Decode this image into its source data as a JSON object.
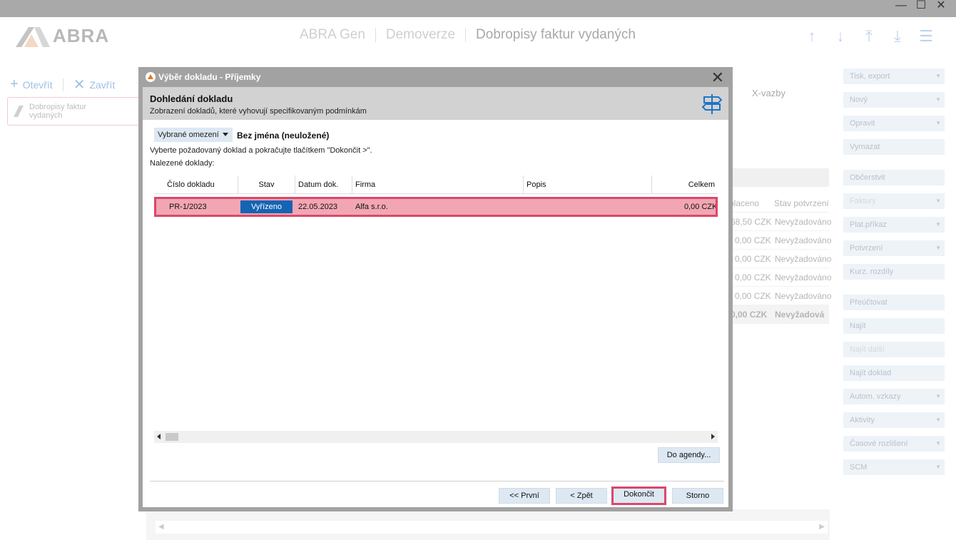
{
  "window": {
    "controls": [
      "—",
      "☐",
      "✕"
    ]
  },
  "app": {
    "logo_text": "ABRA",
    "breadcrumbs": [
      "ABRA Gen",
      "Demoverze",
      "Dobropisy faktur vydaných"
    ],
    "toolbar": {
      "open_label": "Otevřít",
      "close_label": "Zavřít"
    },
    "left_tab_label": "Dobropisy faktur vydaných",
    "bg_tab": "X-vazby",
    "bg_columns": [
      "placeno",
      "Stav potvrzení"
    ],
    "bg_rows": [
      {
        "amount": "68,50 CZK",
        "status": "Nevyžadováno"
      },
      {
        "amount": "0,00 CZK",
        "status": "Nevyžadováno"
      },
      {
        "amount": "0,00 CZK",
        "status": "Nevyžadováno"
      },
      {
        "amount": "0,00 CZK",
        "status": "Nevyžadováno"
      },
      {
        "amount": "0,00 CZK",
        "status": "Nevyžadováno"
      },
      {
        "amount": "0,00 CZK",
        "status": "Nevyžadová"
      }
    ],
    "right_buttons": [
      {
        "label": "Tisk, export",
        "dropdown": true
      },
      {
        "label": "Nový",
        "dropdown": true
      },
      {
        "label": "Opravit",
        "dropdown": true
      },
      {
        "label": "Vymazat",
        "dropdown": false
      },
      {
        "label": "Občerstvit",
        "dropdown": false
      },
      {
        "label": "Faktury",
        "dropdown": true
      },
      {
        "label": "Plat.příkaz",
        "dropdown": true
      },
      {
        "label": "Potvrzení",
        "dropdown": true
      },
      {
        "label": "Kurz. rozdíly",
        "dropdown": false
      },
      {
        "label": "Přeúčtovat",
        "dropdown": false
      },
      {
        "label": "Najít",
        "dropdown": false
      },
      {
        "label": "Najít další",
        "dropdown": false
      },
      {
        "label": "Najít doklad",
        "dropdown": false
      },
      {
        "label": "Autom. vzkazy",
        "dropdown": true
      },
      {
        "label": "Aktivity",
        "dropdown": true
      },
      {
        "label": "Časové rozlišení",
        "dropdown": true
      },
      {
        "label": "SCM",
        "dropdown": true
      }
    ]
  },
  "dialog": {
    "title": "Výběr dokladu - Příjemky",
    "header_title": "Dohledání dokladu",
    "header_subtitle": "Zobrazení dokladů, které vyhovují specifikovaným podmínkám",
    "filter_select": "Vybrané omezení",
    "filter_name": "Bez jména (neuložené)",
    "instruction": "Vyberte požadovaný doklad a pokračujte tlačítkem \"Dokončit >\".",
    "found_label": "Nalezené doklady:",
    "columns": {
      "number": "Číslo dokladu",
      "status": "Stav",
      "date": "Datum dok.",
      "company": "Firma",
      "description": "Popis",
      "total": "Celkem"
    },
    "rows": [
      {
        "number": "PR-1/2023",
        "status": "Vyřízeno",
        "date": "22.05.2023",
        "company": "Alfa s.r.o.",
        "description": "",
        "total": "0,00 CZK"
      }
    ],
    "to_agenda_button": "Do agendy...",
    "buttons": {
      "first": "<< První",
      "back": "< Zpět",
      "finish": "Dokončit",
      "cancel": "Storno"
    }
  },
  "colors": {
    "selection": "#f2a6b3",
    "selection_border": "#d9486a",
    "status_badge": "#1464b4"
  }
}
